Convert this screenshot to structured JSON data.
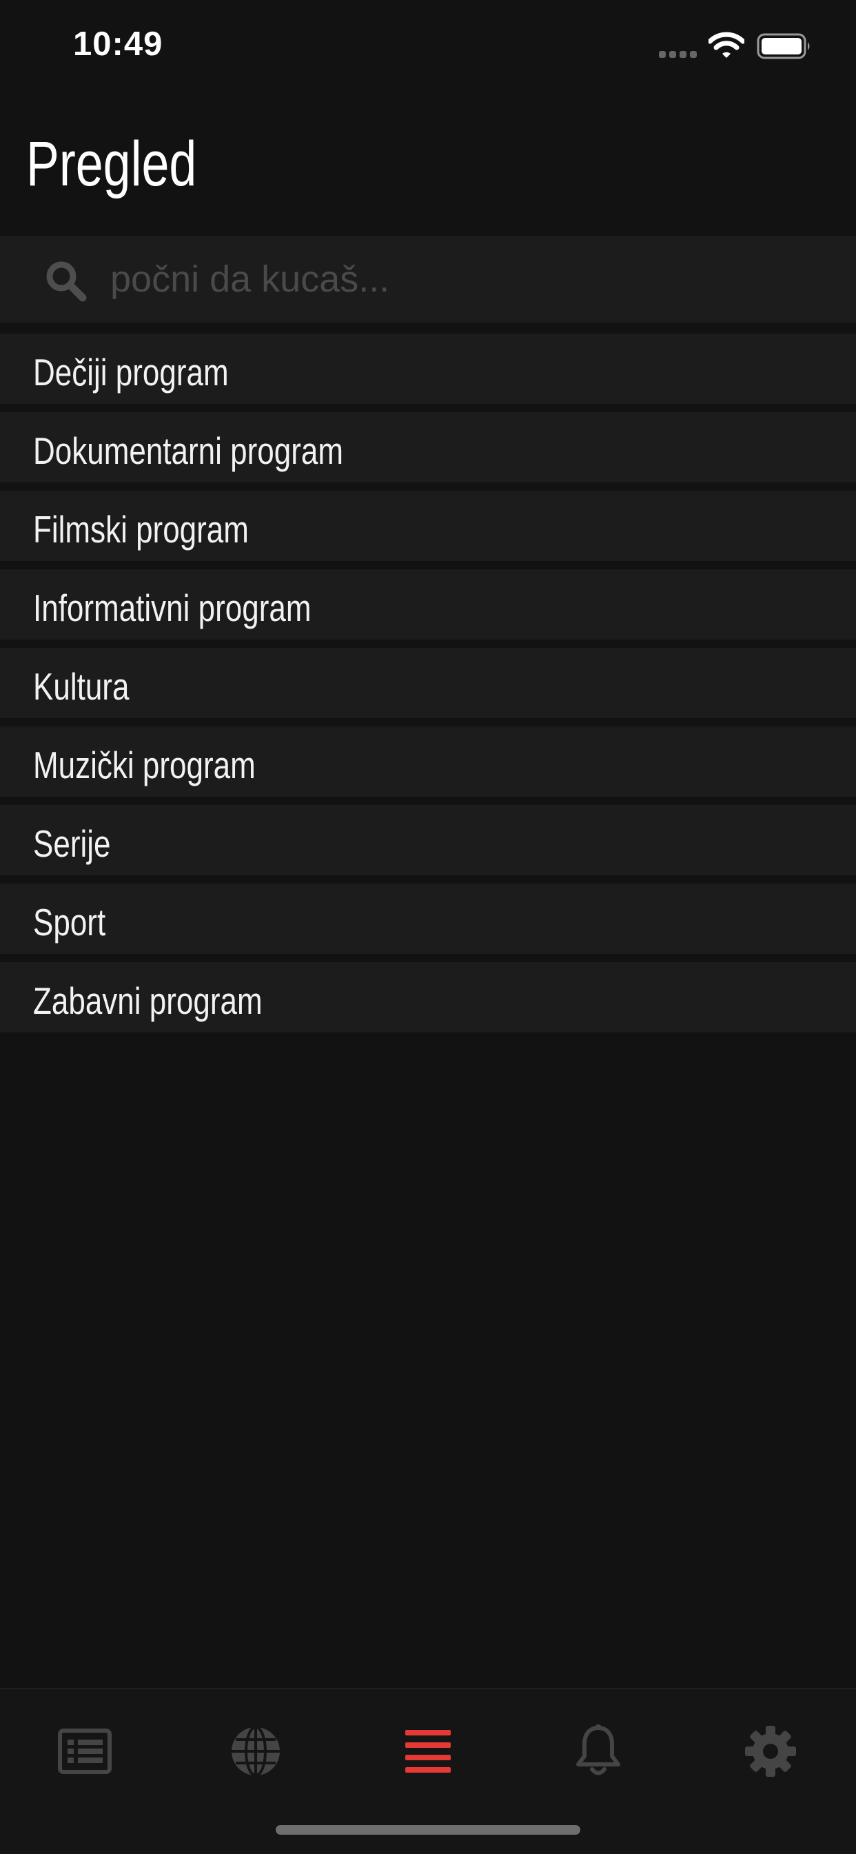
{
  "status_bar": {
    "time": "10:49"
  },
  "header": {
    "title": "Pregled"
  },
  "search": {
    "placeholder": "počni da kucaš..."
  },
  "categories": [
    {
      "label": "Dečiji program"
    },
    {
      "label": "Dokumentarni program"
    },
    {
      "label": "Filmski program"
    },
    {
      "label": "Informativni program"
    },
    {
      "label": "Kultura"
    },
    {
      "label": "Muzički program"
    },
    {
      "label": "Serije"
    },
    {
      "label": "Sport"
    },
    {
      "label": "Zabavni program"
    }
  ],
  "tab_bar": {
    "active_index": 2,
    "tabs": [
      {
        "icon": "news-list-icon"
      },
      {
        "icon": "globe-icon"
      },
      {
        "icon": "menu-icon"
      },
      {
        "icon": "bell-icon"
      },
      {
        "icon": "gear-icon"
      }
    ]
  },
  "colors": {
    "background": "#121212",
    "row_background": "#1c1c1c",
    "accent": "#e53935",
    "inactive_icon": "#454545"
  }
}
